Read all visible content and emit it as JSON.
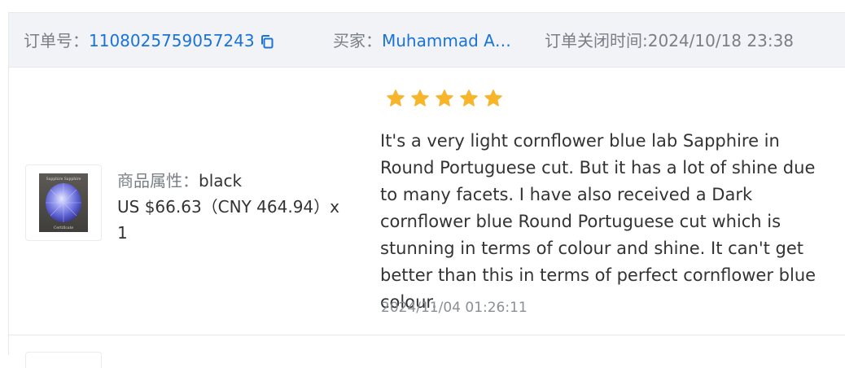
{
  "order": {
    "order_no_label": "订单号：",
    "order_no": "1108025759057243",
    "buyer_label": "买家：",
    "buyer_name": "Muhammad Am...",
    "close_time_label": "订单关闭时间:",
    "close_time": "2024/10/18 23:38"
  },
  "product": {
    "attr_label": "商品属性：",
    "attr_value": "black",
    "price_line": "US $66.63（CNY  464.94）x",
    "quantity": "1",
    "thumb_caption_top": "Sapphire Sapphire",
    "thumb_caption_bottom": "Certificate"
  },
  "review": {
    "rating": 5,
    "rating_max": 5,
    "text": "It's a very light cornflower blue lab Sapphire in Round Portuguese cut. But it has a lot of shine due to many facets. I have also received a Dark cornflower blue Round Portuguese cut which is stunning in terms of colour and shine. It can't get better than this in terms of perfect cornflower blue colour.",
    "date": "2024/11/04 01:26:11"
  },
  "colors": {
    "link": "#1a73d9",
    "star": "#f7b52c",
    "header_bg": "#f1f3f6"
  },
  "icons": {
    "copy": "copy-icon",
    "star": "star-icon"
  }
}
